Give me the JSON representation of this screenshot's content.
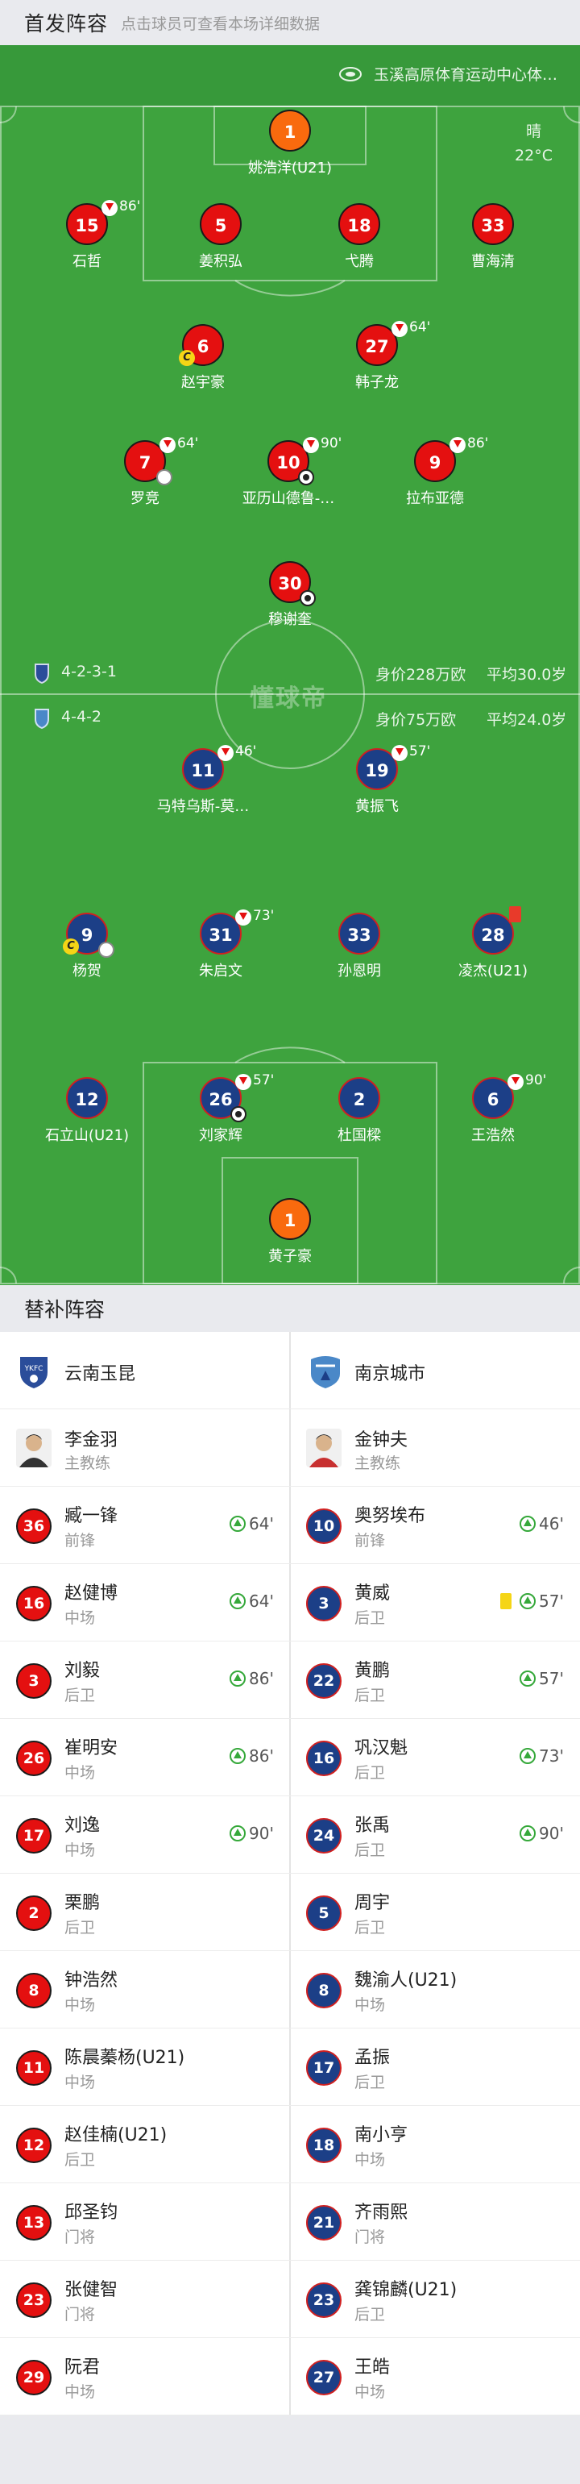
{
  "header": {
    "title": "首发阵容",
    "hint": "点击球员可查看本场详细数据"
  },
  "venue": {
    "name": "玉溪高原体育运动中心体…"
  },
  "weather": {
    "condition": "晴",
    "temp": "22°C"
  },
  "watermark": "懂球帝",
  "home": {
    "name": "云南玉昆",
    "formation": "4-2-3-1",
    "value": "身价228万欧",
    "age": "平均30.0岁",
    "players": [
      {
        "num": "1",
        "name": "姚浩洋(U21)",
        "kit": "gk"
      },
      {
        "num": "15",
        "name": "石哲",
        "kit": "red",
        "sub": "86'"
      },
      {
        "num": "5",
        "name": "姜积弘",
        "kit": "red"
      },
      {
        "num": "18",
        "name": "弋腾",
        "kit": "red"
      },
      {
        "num": "33",
        "name": "曹海清",
        "kit": "red"
      },
      {
        "num": "6",
        "name": "赵宇豪",
        "kit": "red",
        "captain": "C"
      },
      {
        "num": "27",
        "name": "韩子龙",
        "kit": "red",
        "sub": "64'"
      },
      {
        "num": "7",
        "name": "罗竞",
        "kit": "red",
        "sub": "64'"
      },
      {
        "num": "10",
        "name": "亚历山德鲁-…",
        "kit": "red",
        "sub": "90'"
      },
      {
        "num": "9",
        "name": "拉布亚德",
        "kit": "red",
        "sub": "86'"
      },
      {
        "num": "30",
        "name": "穆谢奎",
        "kit": "red"
      }
    ]
  },
  "away": {
    "name": "南京城市",
    "formation": "4-4-2",
    "value": "身价75万欧",
    "age": "平均24.0岁",
    "players": [
      {
        "num": "11",
        "name": "马特乌斯-莫…",
        "kit": "blue",
        "sub": "46'"
      },
      {
        "num": "19",
        "name": "黄振飞",
        "kit": "blue",
        "sub": "57'"
      },
      {
        "num": "9",
        "name": "杨贺",
        "kit": "blue",
        "captain": "C"
      },
      {
        "num": "31",
        "name": "朱启文",
        "kit": "blue",
        "sub": "73'"
      },
      {
        "num": "33",
        "name": "孙恩明",
        "kit": "blue"
      },
      {
        "num": "28",
        "name": "凌杰(U21)",
        "kit": "blue"
      },
      {
        "num": "12",
        "name": "石立山(U21)",
        "kit": "blue"
      },
      {
        "num": "26",
        "name": "刘家辉",
        "kit": "blue",
        "sub": "57'"
      },
      {
        "num": "2",
        "name": "杜国樑",
        "kit": "blue"
      },
      {
        "num": "6",
        "name": "王浩然",
        "kit": "blue",
        "sub": "90'"
      },
      {
        "num": "1",
        "name": "黄子豪",
        "kit": "gk"
      }
    ]
  },
  "subs_section": {
    "title": "替补阵容"
  },
  "coaches": {
    "home": {
      "name": "李金羽",
      "role": "主教练"
    },
    "away": {
      "name": "金钟夫",
      "role": "主教练"
    }
  },
  "bench": {
    "home": [
      {
        "num": "36",
        "name": "臧一锋",
        "pos": "前锋",
        "on": "64'"
      },
      {
        "num": "16",
        "name": "赵健博",
        "pos": "中场",
        "on": "64'"
      },
      {
        "num": "3",
        "name": "刘毅",
        "pos": "后卫",
        "on": "86'"
      },
      {
        "num": "26",
        "name": "崔明安",
        "pos": "中场",
        "on": "86'"
      },
      {
        "num": "17",
        "name": "刘逸",
        "pos": "中场",
        "on": "90'"
      },
      {
        "num": "2",
        "name": "栗鹏",
        "pos": "后卫"
      },
      {
        "num": "8",
        "name": "钟浩然",
        "pos": "中场"
      },
      {
        "num": "11",
        "name": "陈晨蓁杨(U21)",
        "pos": "中场"
      },
      {
        "num": "12",
        "name": "赵佳楠(U21)",
        "pos": "后卫"
      },
      {
        "num": "13",
        "name": "邱圣钧",
        "pos": "门将"
      },
      {
        "num": "23",
        "name": "张健智",
        "pos": "门将"
      },
      {
        "num": "29",
        "name": "阮君",
        "pos": "中场"
      }
    ],
    "away": [
      {
        "num": "10",
        "name": "奥努埃布",
        "pos": "前锋",
        "on": "46'"
      },
      {
        "num": "3",
        "name": "黄威",
        "pos": "后卫",
        "on": "57'",
        "yellow": true
      },
      {
        "num": "22",
        "name": "黄鹏",
        "pos": "后卫",
        "on": "57'"
      },
      {
        "num": "16",
        "name": "巩汉魁",
        "pos": "后卫",
        "on": "73'"
      },
      {
        "num": "24",
        "name": "张禹",
        "pos": "后卫",
        "on": "90'"
      },
      {
        "num": "5",
        "name": "周宇",
        "pos": "后卫"
      },
      {
        "num": "8",
        "name": "魏渝人(U21)",
        "pos": "中场"
      },
      {
        "num": "17",
        "name": "孟振",
        "pos": "后卫"
      },
      {
        "num": "18",
        "name": "南小亨",
        "pos": "中场"
      },
      {
        "num": "21",
        "name": "齐雨熙",
        "pos": "门将"
      },
      {
        "num": "23",
        "name": "龚锦麟(U21)",
        "pos": "后卫"
      },
      {
        "num": "27",
        "name": "王皓",
        "pos": "中场"
      }
    ]
  }
}
